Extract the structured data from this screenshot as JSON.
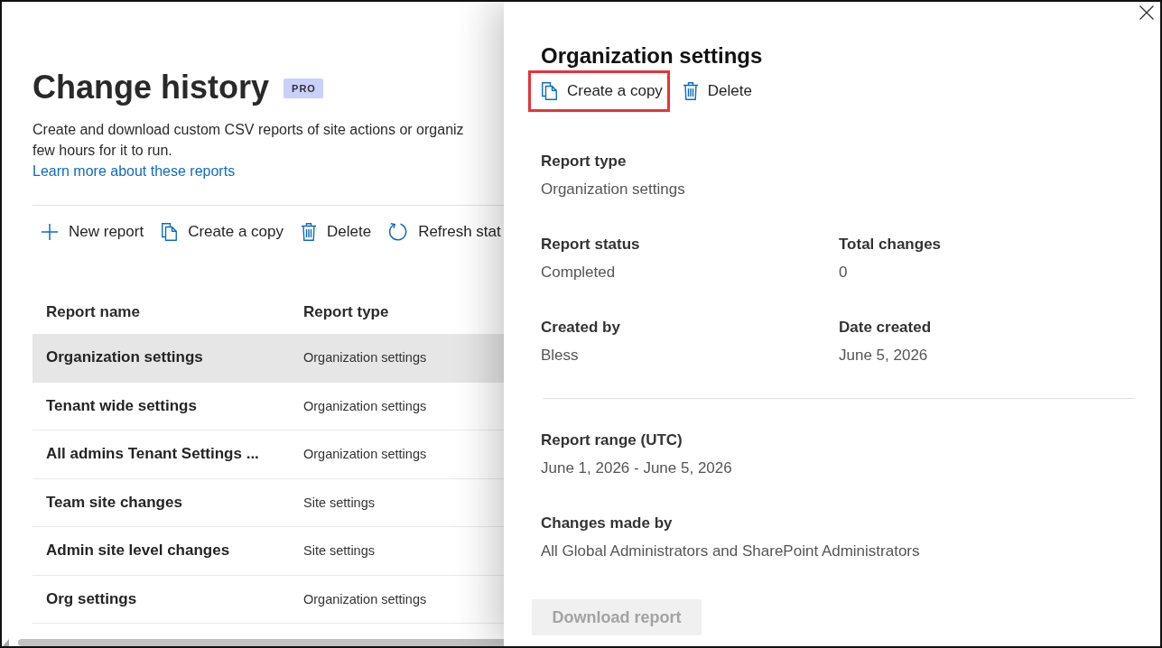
{
  "page": {
    "title": "Change history",
    "badge": "PRO",
    "description_lines": [
      "Create and download custom CSV reports of site actions or organiz",
      "few hours for it to run."
    ],
    "link": "Learn more about these reports",
    "toolbar": [
      {
        "kind": "new",
        "label": "New report"
      },
      {
        "kind": "copy",
        "label": "Create a copy"
      },
      {
        "kind": "delete",
        "label": "Delete"
      },
      {
        "kind": "refresh",
        "label": "Refresh stat"
      }
    ],
    "table": {
      "columns": [
        "Report name",
        "Report type"
      ],
      "rows": [
        {
          "name": "Organization settings",
          "type": "Organization settings",
          "selected": true
        },
        {
          "name": "Tenant wide settings",
          "type": "Organization settings",
          "selected": false
        },
        {
          "name": "All admins Tenant Settings ...",
          "type": "Organization settings",
          "selected": false
        },
        {
          "name": "Team site changes",
          "type": "Site settings",
          "selected": false
        },
        {
          "name": "Admin site level changes",
          "type": "Site settings",
          "selected": false
        },
        {
          "name": "Org settings",
          "type": "Organization settings",
          "selected": false
        }
      ]
    }
  },
  "details_panel": {
    "title": "Organization settings",
    "actions": [
      {
        "kind": "copy",
        "label": "Create a copy",
        "highlighted": true
      },
      {
        "kind": "delete",
        "label": "Delete",
        "highlighted": false
      }
    ],
    "field_groups": [
      {
        "rows": [
          [
            {
              "label": "Report type",
              "value": "Organization settings"
            }
          ],
          [
            {
              "label": "Report status",
              "value": "Completed"
            },
            {
              "label": "Total changes",
              "value": "0"
            }
          ],
          [
            {
              "label": "Created by",
              "value": "Bless"
            },
            {
              "label": "Date created",
              "value": "June 5, 2026"
            }
          ]
        ]
      },
      {
        "rows": [
          [
            {
              "label": "Report range (UTC)",
              "value": "June 1, 2026 - June 5, 2026"
            }
          ],
          [
            {
              "label": "Changes made by",
              "value": "All Global Administrators and SharePoint Administrators"
            }
          ]
        ]
      }
    ],
    "button": {
      "label": "Download report",
      "disabled": true
    }
  }
}
